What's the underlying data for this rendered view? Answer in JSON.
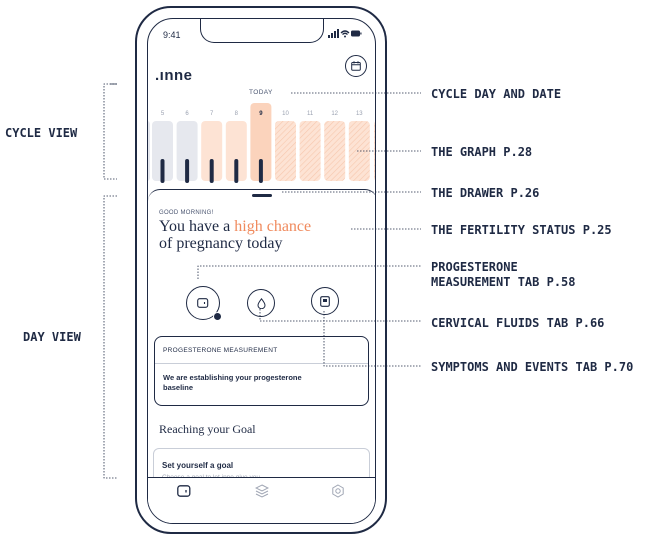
{
  "status_bar": {
    "time": "9:41"
  },
  "app": {
    "logo": ".ınne",
    "today_label": "TODAY"
  },
  "cycle": {
    "days": [
      "5",
      "6",
      "7",
      "8",
      "9",
      "10",
      "11",
      "12",
      "13"
    ],
    "selected_day": "9"
  },
  "drawer": {
    "greeting": "GOOD MORNING!",
    "headline_pre": "You have a ",
    "headline_highlight": "high chance",
    "headline_post": "of pregnancy today"
  },
  "tabs": [
    {
      "icon": "progesterone-icon"
    },
    {
      "icon": "droplet-icon"
    },
    {
      "icon": "symptoms-icon"
    }
  ],
  "progesterone_card": {
    "title": "PROGESTERONE MEASUREMENT",
    "body": "We are establishing your progesterone baseline"
  },
  "goal": {
    "heading": "Reaching your Goal",
    "card_title": "Set yourself a goal",
    "card_sub": "Choose a goal to let inne give you personalised recommendations."
  },
  "bottom_nav": [
    {
      "icon": "tracker-icon"
    },
    {
      "icon": "layers-icon"
    },
    {
      "icon": "settings-icon"
    }
  ],
  "annotations": {
    "cycle_view": "CYCLE VIEW",
    "day_view": "DAY VIEW",
    "cycle_day_date": "CYCLE DAY AND DATE",
    "graph": "THE GRAPH P.28",
    "drawer": "THE DRAWER P.26",
    "fertility": "THE FERTILITY STATUS P.25",
    "progesterone_l1": "PROGESTERONE",
    "progesterone_l2": "MEASUREMENT TAB P.58",
    "cervical": "CERVICAL FLUIDS TAB P.66",
    "symptoms": "SYMPTOMS AND EVENTS TAB P.70"
  },
  "colors": {
    "navy": "#1f2a44",
    "peach": "#fde3d4",
    "peach_stripe": "#f7c7ad",
    "grey_col": "#e6e8ee",
    "accent": "#f08a5d"
  }
}
